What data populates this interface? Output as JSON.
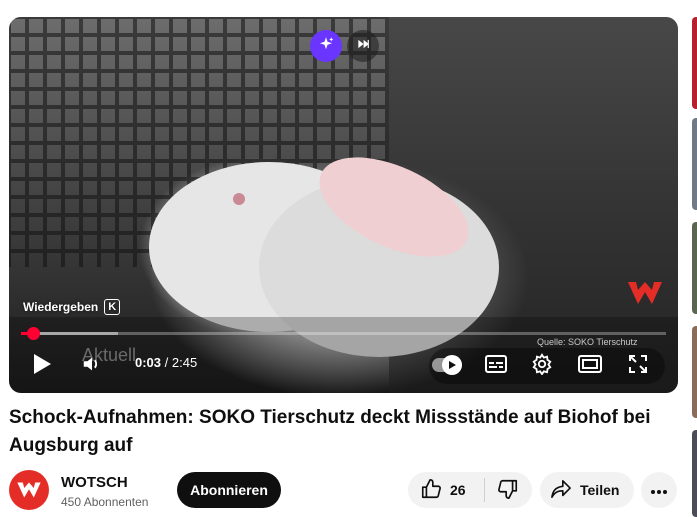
{
  "player": {
    "tooltip_label": "Wiedergeben",
    "tooltip_key": "K",
    "current_time": "0:03",
    "separator": "/",
    "duration": "2:45",
    "overlay_text": "Aktuell",
    "source_credit": "Quelle: SOKO Tierschutz",
    "played_fraction": 0.018,
    "loaded_fraction": 0.15
  },
  "video": {
    "title": "Schock-Aufnahmen: SOKO Tierschutz deckt Missstände auf Biohof bei Augsburg auf"
  },
  "channel": {
    "name": "WOTSCH",
    "subscribers": "450 Abonnenten",
    "subscribe_label": "Abonnieren"
  },
  "actions": {
    "like_count": "26",
    "share_label": "Teilen"
  },
  "colors": {
    "accent_red": "#ff0033",
    "ai_purple": "#6a35ff",
    "brand_red": "#e52d27"
  },
  "icons": [
    "sparkle-icon",
    "skip-next-icon",
    "play-icon",
    "volume-icon",
    "autoplay-icon",
    "subtitles-icon",
    "settings-icon",
    "theater-icon",
    "fullscreen-icon",
    "thumbs-up-icon",
    "thumbs-down-icon",
    "share-icon",
    "more-icon"
  ]
}
